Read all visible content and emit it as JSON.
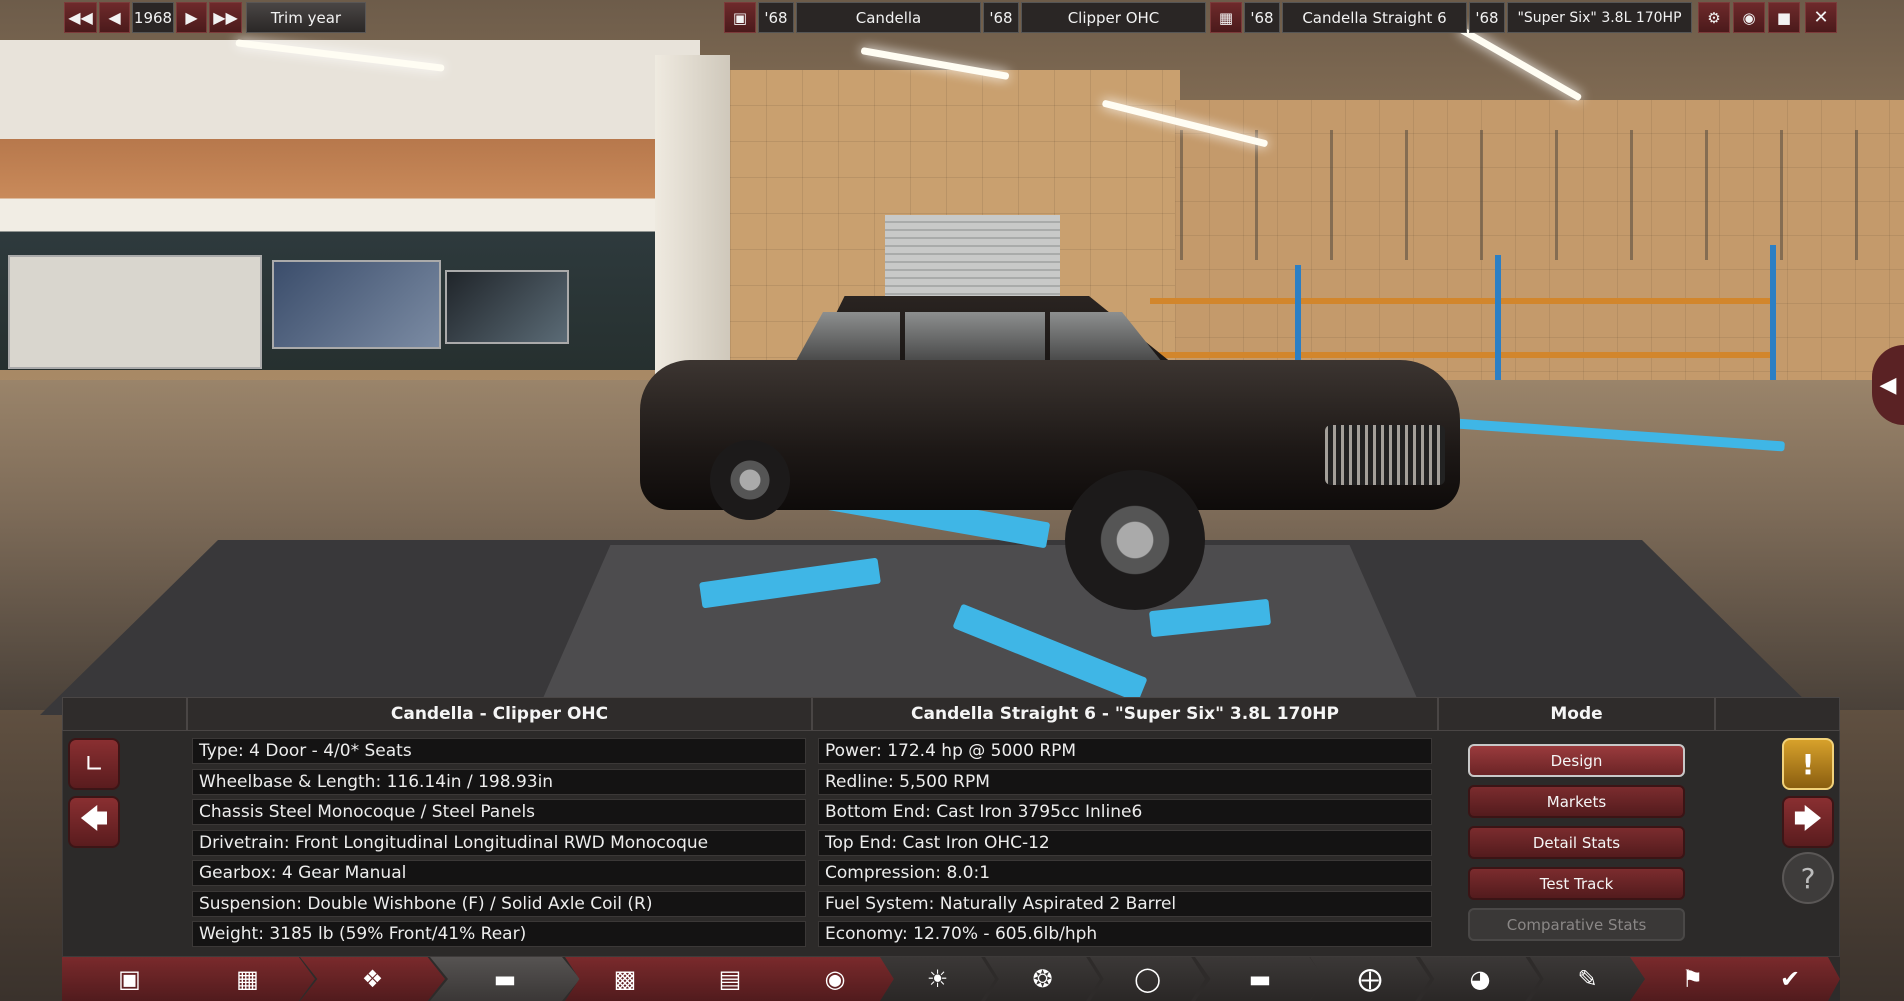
{
  "top_bar": {
    "year": "1968",
    "trim_label": "Trim year",
    "model_year": "'68",
    "model_name": "Candella",
    "trim_year": "'68",
    "trim_name": "Clipper OHC",
    "engine_year": "'68",
    "engine_name": "Candella Straight 6",
    "variant_year": "'68",
    "variant_name": "\"Super Six\" 3.8L 170HP"
  },
  "panel": {
    "car_header": "Candella - Clipper OHC",
    "engine_header": "Candella Straight 6 - \"Super Six\" 3.8L 170HP",
    "mode_header": "Mode",
    "car_stats": [
      "Type: 4 Door - 4/0* Seats",
      "Wheelbase & Length: 116.14in / 198.93in",
      "Chassis Steel Monocoque / Steel Panels",
      "Drivetrain: Front Longitudinal Longitudinal RWD Monocoque",
      "Gearbox: 4 Gear Manual",
      "Suspension: Double Wishbone (F) / Solid Axle Coil (R)",
      "Weight: 3185 lb (59% Front/41% Rear)"
    ],
    "engine_stats": [
      "Power: 172.4 hp @ 5000 RPM",
      "Redline:  5,500 RPM",
      "Bottom End: Cast Iron 3795cc Inline6",
      "Top End: Cast Iron OHC-12",
      "Compression: 8.0:1",
      "Fuel System: Naturally Aspirated 2 Barrel",
      "Economy: 12.70% - 605.6lb/hph"
    ],
    "mode_buttons": [
      "Design",
      "Markets",
      "Detail Stats",
      "Test Track",
      "Comparative Stats"
    ]
  },
  "icons": {
    "top": [
      "rewind-icon",
      "step-back-icon",
      "step-forward-icon",
      "fast-forward-icon",
      "car-icon",
      "engine-icon",
      "settings-icon",
      "camera-icon",
      "save-icon",
      "close-icon"
    ],
    "nav": [
      "car-model-icon",
      "chassis-icon",
      "suspension-icon",
      "body-icon",
      "fixtures-icon",
      "interior-icon",
      "engine-icon",
      "gearbox-icon",
      "wheels-icon",
      "brakes-icon",
      "aero-icon",
      "steering-icon",
      "tuning-icon",
      "testing-icon",
      "finish-icon"
    ]
  },
  "colors": {
    "accent_red": "#7a2a2c",
    "warning_gold": "#d7a12b",
    "lift_blue": "#3fb6e6"
  }
}
